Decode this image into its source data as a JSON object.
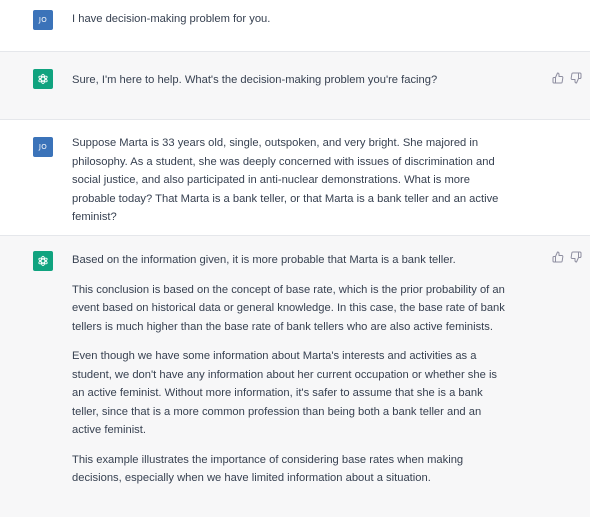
{
  "conversation": {
    "user_initials": "JO",
    "messages": [
      {
        "role": "user",
        "paragraphs": [
          "I have decision-making problem for you."
        ]
      },
      {
        "role": "assistant",
        "paragraphs": [
          "Sure, I'm here to help. What's the decision-making problem you're facing?"
        ]
      },
      {
        "role": "user",
        "paragraphs": [
          "Suppose Marta is 33 years old, single, outspoken, and very bright. She majored in philosophy. As a student, she was deeply concerned with issues of discrimination and social justice, and also participated in anti-nuclear demonstrations. What is more probable today? That Marta is a bank teller, or that Marta is a bank teller and an active feminist?"
        ]
      },
      {
        "role": "assistant",
        "paragraphs": [
          "Based on the information given, it is more probable that Marta is a bank teller.",
          "This conclusion is based on the concept of base rate, which is the prior probability of an event based on historical data or general knowledge. In this case, the base rate of bank tellers is much higher than the base rate of bank tellers who are also active feminists.",
          "Even though we have some information about Marta's interests and activities as a student, we don't have any information about her current occupation or whether she is an active feminist. Without more information, it's safer to assume that she is a bank teller, since that is a more common profession than being both a bank teller and an active feminist.",
          "This example illustrates the importance of considering base rates when making decisions, especially when we have limited information about a situation."
        ]
      }
    ]
  },
  "icons": {
    "assistant_avatar": "openai-logo-icon",
    "feedback_up": "thumbs-up-icon",
    "feedback_down": "thumbs-down-icon"
  },
  "colors": {
    "user_avatar": "#3b73b9",
    "assistant_avatar": "#10a37f",
    "assistant_background": "#f7f7f8"
  }
}
